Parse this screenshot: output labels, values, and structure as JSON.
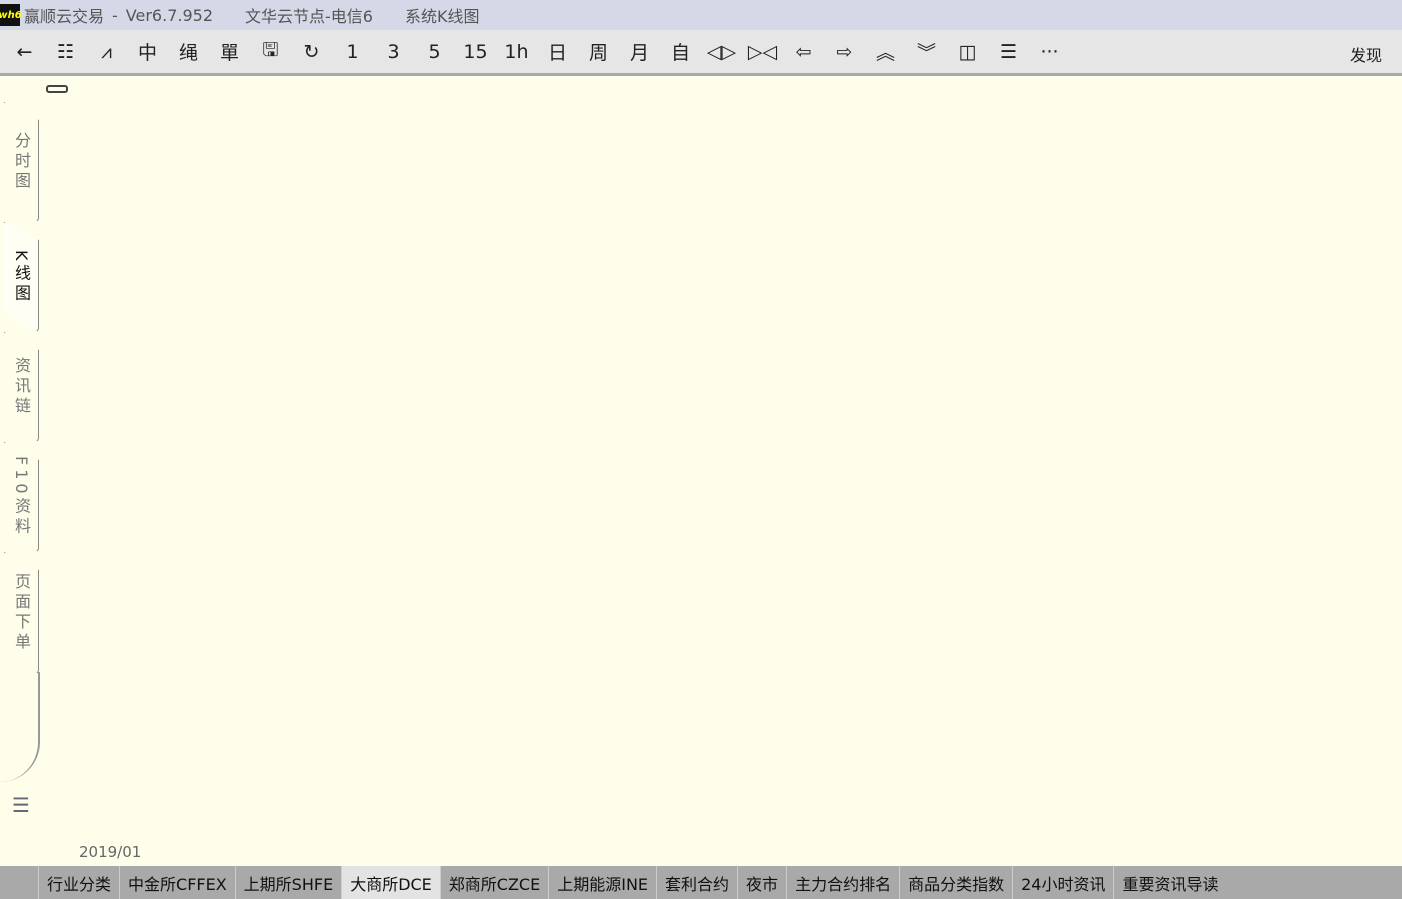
{
  "title": {
    "app": "赢顺云交易",
    "sep": "-",
    "version": "Ver6.7.952",
    "node": "文华云节点-电信6",
    "view": "系统K线图",
    "logo": "wh6"
  },
  "toolbar": {
    "items": [
      {
        "icon": "back-arrow-icon",
        "glyph": "←"
      },
      {
        "icon": "list-icon",
        "glyph": "☷"
      },
      {
        "icon": "line-chart-icon",
        "glyph": "⩘"
      },
      {
        "icon": "candle-icon",
        "glyph": "中"
      },
      {
        "icon": "draw-icon",
        "glyph": "绳"
      },
      {
        "icon": "order-icon",
        "glyph": "單"
      },
      {
        "icon": "save-icon",
        "glyph": "🖫"
      },
      {
        "icon": "refresh-icon",
        "glyph": "↻"
      },
      {
        "icon": "period-1",
        "glyph": "1"
      },
      {
        "icon": "period-3",
        "glyph": "3"
      },
      {
        "icon": "period-5",
        "glyph": "5"
      },
      {
        "icon": "period-15",
        "glyph": "15"
      },
      {
        "icon": "period-1h",
        "glyph": "1h"
      },
      {
        "icon": "period-day",
        "glyph": "日"
      },
      {
        "icon": "period-week",
        "glyph": "周"
      },
      {
        "icon": "period-month",
        "glyph": "月"
      },
      {
        "icon": "period-custom",
        "glyph": "自"
      },
      {
        "icon": "zoom-in-icon",
        "glyph": "◁▷"
      },
      {
        "icon": "zoom-out-icon",
        "glyph": "▷◁"
      },
      {
        "icon": "left-icon",
        "glyph": "⇦"
      },
      {
        "icon": "right-icon",
        "glyph": "⇨"
      },
      {
        "icon": "up-icon",
        "glyph": "︽"
      },
      {
        "icon": "down-icon",
        "glyph": "︾"
      },
      {
        "icon": "layout-icon",
        "glyph": "◫"
      },
      {
        "icon": "text-icon",
        "glyph": "☰"
      },
      {
        "icon": "more-icon",
        "glyph": "···"
      }
    ],
    "discover": "发现"
  },
  "side_tabs": [
    {
      "label": "分时图",
      "active": false
    },
    {
      "label": "K线图",
      "active": true
    },
    {
      "label": "资讯链",
      "active": false
    },
    {
      "label": "F10资料",
      "active": false
    },
    {
      "label": "页面下单",
      "active": false
    }
  ],
  "chart": {
    "date_label": "2019/01"
  },
  "bottom_tabs": [
    {
      "label": "行业分类"
    },
    {
      "label": "中金所CFFEX"
    },
    {
      "label": "上期所SHFE"
    },
    {
      "label": "大商所DCE",
      "active": true
    },
    {
      "label": "郑商所CZCE"
    },
    {
      "label": "上期能源INE"
    },
    {
      "label": "套利合约"
    },
    {
      "label": "夜市"
    },
    {
      "label": "主力合约排名"
    },
    {
      "label": "商品分类指数"
    },
    {
      "label": "24小时资讯"
    },
    {
      "label": "重要资讯导读"
    }
  ]
}
